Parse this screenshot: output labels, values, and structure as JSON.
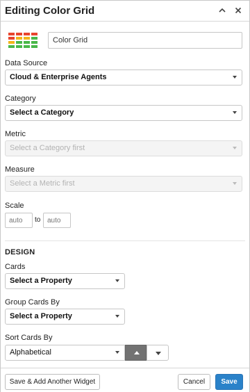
{
  "header": {
    "title": "Editing Color Grid",
    "collapse_icon": "chevron-up-icon",
    "close_icon": "close-icon"
  },
  "widget": {
    "logo_icon": "color-grid-icon",
    "name_value": "Color Grid"
  },
  "fields": {
    "data_source": {
      "label": "Data Source",
      "value": "Cloud & Enterprise Agents"
    },
    "category": {
      "label": "Category",
      "value": "Select a Category"
    },
    "metric": {
      "label": "Metric",
      "value": "Select a Category first",
      "disabled": true
    },
    "measure": {
      "label": "Measure",
      "value": "Select a Metric first",
      "disabled": true
    },
    "scale": {
      "label": "Scale",
      "min_placeholder": "auto",
      "to_label": "to",
      "max_placeholder": "auto"
    }
  },
  "design": {
    "heading": "DESIGN",
    "cards": {
      "label": "Cards",
      "value": "Select a Property"
    },
    "group_cards_by": {
      "label": "Group Cards By",
      "value": "Select a Property"
    },
    "sort_cards_by": {
      "label": "Sort Cards By",
      "value": "Alphabetical",
      "direction": "ascending"
    }
  },
  "footer": {
    "save_add_label": "Save & Add Another Widget",
    "cancel_label": "Cancel",
    "save_label": "Save"
  },
  "colors": {
    "primary": "#2a82c9",
    "logo_red": "#e8452e",
    "logo_yellow": "#f2b51b",
    "logo_green": "#49b849"
  }
}
